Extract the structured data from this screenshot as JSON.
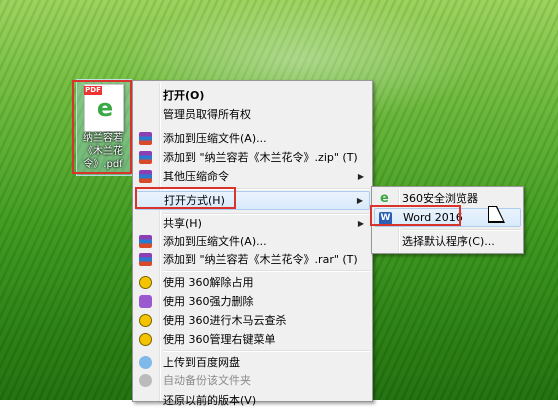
{
  "desktop_icon": {
    "badge": "PDF",
    "label": "纳兰容若《木兰花令》.pdf"
  },
  "context_menu": {
    "items": [
      {
        "label": "打开(O)"
      },
      {
        "label": "管理员取得所有权"
      },
      {
        "label": "添加到压缩文件(A)..."
      },
      {
        "label": "添加到 \"纳兰容若《木兰花令》.zip\" (T)"
      },
      {
        "label": "其他压缩命令"
      },
      {
        "label": "打开方式(H)"
      },
      {
        "label": "共享(H)"
      },
      {
        "label": "添加到压缩文件(A)..."
      },
      {
        "label": "添加到 \"纳兰容若《木兰花令》.rar\" (T)"
      },
      {
        "label": "使用 360解除占用"
      },
      {
        "label": "使用 360强力删除"
      },
      {
        "label": "使用 360进行木马云查杀"
      },
      {
        "label": "使用 360管理右键菜单"
      },
      {
        "label": "上传到百度网盘"
      },
      {
        "label": "自动备份该文件夹"
      },
      {
        "label": "还原以前的版本(V)"
      }
    ]
  },
  "submenu": {
    "items": [
      {
        "label": "360安全浏览器"
      },
      {
        "label": "Word 2016"
      },
      {
        "label": "选择默认程序(C)..."
      }
    ]
  },
  "icons": {
    "archive": "winrar-icon",
    "browser": "360-browser-icon",
    "word": "word-icon"
  },
  "colors": {
    "highlight_box": "#d9342b",
    "menu_bg": "#f0f0f0"
  }
}
